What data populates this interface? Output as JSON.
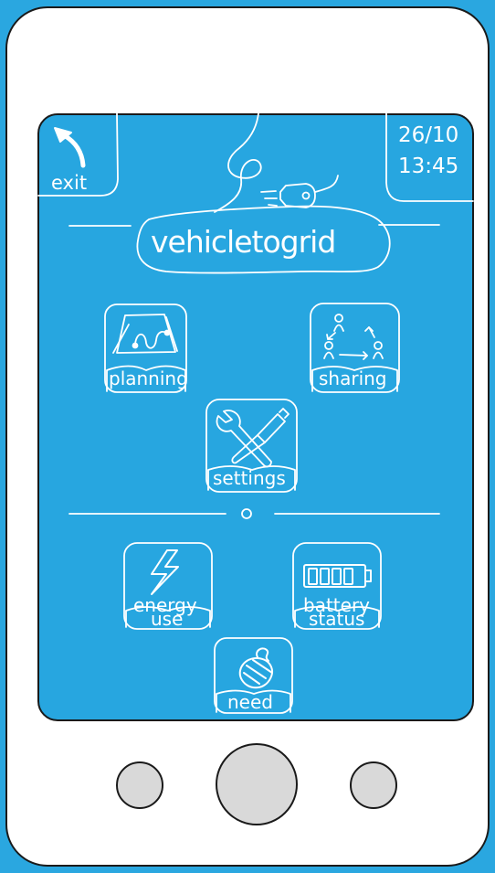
{
  "header": {
    "exit_label": "exit",
    "date": "26/10",
    "time": "13:45"
  },
  "app_title": "vehicletogrid",
  "menu": {
    "planning": "planning",
    "sharing": "sharing",
    "settings": "settings",
    "energy_use_line1": "energy",
    "energy_use_line2": "use",
    "battery_status_line1": "battery",
    "battery_status_line2": "status",
    "need": "need"
  },
  "colors": {
    "screen_bg": "#27a6e0",
    "device_body": "#ffffff",
    "hardware_button": "#d9d9d9",
    "outline": "#1a1a1a",
    "foreground": "#ffffff"
  }
}
